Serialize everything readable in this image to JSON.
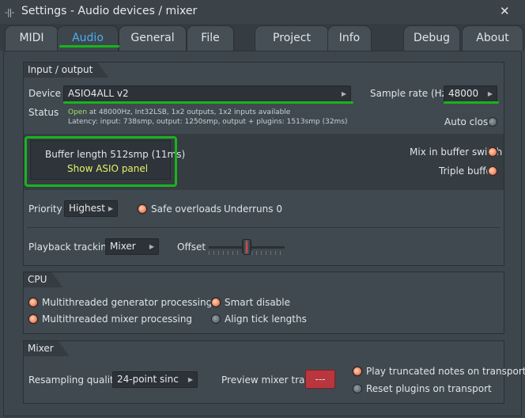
{
  "window": {
    "title": "Settings - Audio devices / mixer",
    "close_glyph": "✕",
    "drag_glyph": "-||-"
  },
  "tabs": [
    {
      "label": "MIDI"
    },
    {
      "label": "Audio"
    },
    {
      "label": "General"
    },
    {
      "label": "File"
    },
    {
      "label": "Project"
    },
    {
      "label": "Info"
    },
    {
      "label": "Debug"
    },
    {
      "label": "About"
    }
  ],
  "active_tab": "Audio",
  "io": {
    "section_title": "Input / output",
    "device_label": "Device",
    "device_value": "ASIO4ALL v2",
    "sample_rate_label": "Sample rate (Hz)",
    "sample_rate_value": "48000",
    "status_label": "Status",
    "status_open": "Open",
    "status_line1": "at 48000Hz, Int32LSB, 1x2 outputs, 1x2 inputs available",
    "status_line2": "Latency: input: 738smp, output: 1250smp, output + plugins: 1513smp (32ms)",
    "auto_close_label": "Auto close",
    "auto_close_on": false,
    "buffer_length_text": "Buffer length 512smp (11ms)",
    "show_asio_label": "Show ASIO panel",
    "mix_in_buffer_label": "Mix in buffer switch",
    "mix_in_buffer_on": true,
    "triple_buffer_label": "Triple buffer",
    "triple_buffer_on": true,
    "priority_label": "Priority",
    "priority_value": "Highest",
    "safe_overloads_label": "Safe overloads",
    "safe_overloads_on": true,
    "underruns_text": "Underruns 0",
    "playback_tracking_label": "Playback tracking",
    "playback_tracking_value": "Mixer",
    "offset_label": "Offset"
  },
  "cpu": {
    "section_title": "CPU",
    "multithreaded_generator_label": "Multithreaded generator processing",
    "multithreaded_generator_on": true,
    "multithreaded_mixer_label": "Multithreaded mixer processing",
    "multithreaded_mixer_on": true,
    "smart_disable_label": "Smart disable",
    "smart_disable_on": true,
    "align_tick_label": "Align tick lengths",
    "align_tick_on": false
  },
  "mixer": {
    "section_title": "Mixer",
    "resampling_label": "Resampling quality",
    "resampling_value": "24-point sinc",
    "preview_label": "Preview mixer track",
    "preview_value": "---",
    "play_truncated_label": "Play truncated notes on transport",
    "play_truncated_on": true,
    "reset_plugins_label": "Reset plugins on transport",
    "reset_plugins_on": false
  },
  "colors": {
    "accent_tab": "#49aef0",
    "highlight_green": "#1bb31f",
    "status_open": "#9be26a",
    "asio_link": "#e3f26a",
    "led_on": "#f0825b",
    "preview_red": "#b8363d"
  }
}
